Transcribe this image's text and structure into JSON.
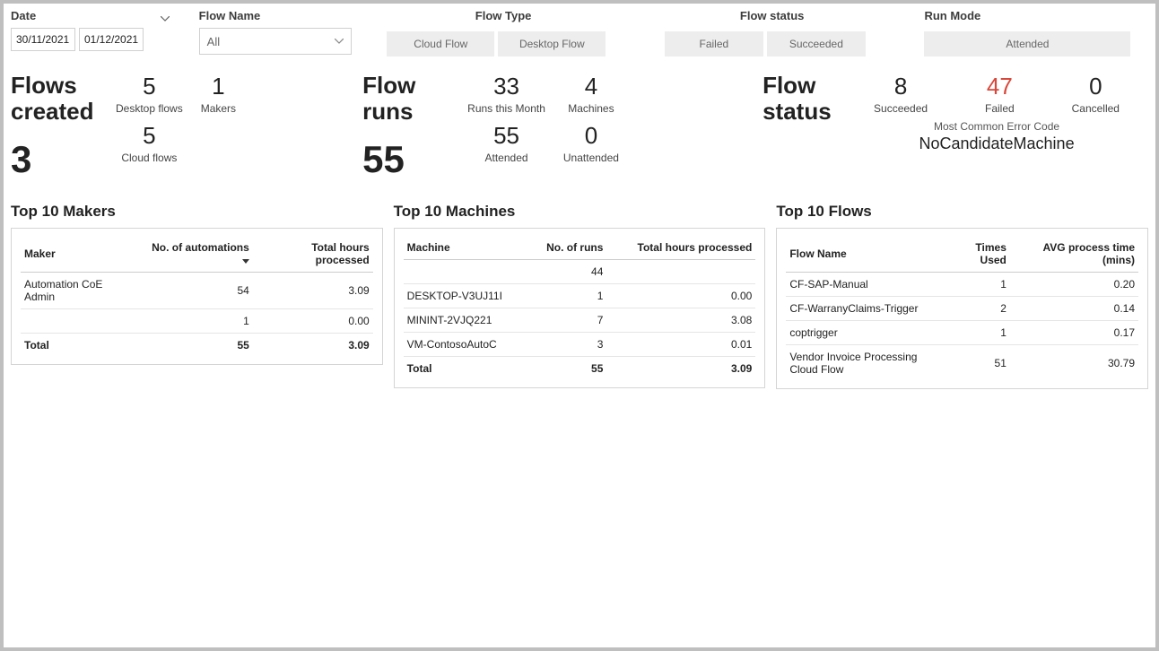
{
  "filters": {
    "date_label": "Date",
    "date_from": "30/11/2021",
    "date_to": "01/12/2021",
    "flowname_label": "Flow Name",
    "flowname_value": "All",
    "flowtype_label": "Flow Type",
    "flowtype_options": [
      "Cloud Flow",
      "Desktop Flow"
    ],
    "flowstatus_label": "Flow status",
    "flowstatus_options": [
      "Failed",
      "Succeeded"
    ],
    "runmode_label": "Run Mode",
    "runmode_options": [
      "Attended"
    ]
  },
  "kpi_created": {
    "title_a": "Flows",
    "title_b": "created",
    "big": "3",
    "sub1_v": "5",
    "sub1_l": "Desktop flows",
    "sub2_v": "5",
    "sub2_l": "Cloud flows",
    "sub3_v": "1",
    "sub3_l": "Makers"
  },
  "kpi_runs": {
    "title_a": "Flow",
    "title_b": "runs",
    "big": "55",
    "sub1_v": "33",
    "sub1_l": "Runs this Month",
    "sub2_v": "55",
    "sub2_l": "Attended",
    "sub3_v": "4",
    "sub3_l": "Machines",
    "sub4_v": "0",
    "sub4_l": "Unattended"
  },
  "kpi_status": {
    "title_a": "Flow",
    "title_b": "status",
    "succ_v": "8",
    "succ_l": "Succeeded",
    "fail_v": "47",
    "fail_l": "Failed",
    "canc_v": "0",
    "canc_l": "Cancelled",
    "err_cap": "Most Common Error Code",
    "err_code": "NoCandidateMachine"
  },
  "makers": {
    "title": "Top 10 Makers",
    "cols": [
      "Maker",
      "No. of automations",
      "Total hours processed"
    ],
    "rows": [
      {
        "maker": "Automation CoE Admin",
        "num": "54",
        "hours": "3.09"
      },
      {
        "maker": "",
        "num": "1",
        "hours": "0.00"
      }
    ],
    "total_label": "Total",
    "total_num": "55",
    "total_hours": "3.09"
  },
  "machines": {
    "title": "Top 10 Machines",
    "cols": [
      "Machine",
      "No. of runs",
      "Total hours processed"
    ],
    "rows": [
      {
        "m": "",
        "r": "44",
        "h": ""
      },
      {
        "m": "DESKTOP-V3UJ11I",
        "r": "1",
        "h": "0.00"
      },
      {
        "m": "MININT-2VJQ221",
        "r": "7",
        "h": "3.08"
      },
      {
        "m": "VM-ContosoAutoC",
        "r": "3",
        "h": "0.01"
      }
    ],
    "total_label": "Total",
    "total_r": "55",
    "total_h": "3.09"
  },
  "flows": {
    "title": "Top 10 Flows",
    "cols": [
      "Flow Name",
      "Times Used",
      "AVG process time (mins)"
    ],
    "rows": [
      {
        "f": "CF-SAP-Manual",
        "t": "1",
        "a": "0.20"
      },
      {
        "f": "CF-WarranyClaims-Trigger",
        "t": "2",
        "a": "0.14"
      },
      {
        "f": "coptrigger",
        "t": "1",
        "a": "0.17"
      },
      {
        "f": "Vendor Invoice Processing Cloud Flow",
        "t": "51",
        "a": "30.79"
      }
    ]
  }
}
